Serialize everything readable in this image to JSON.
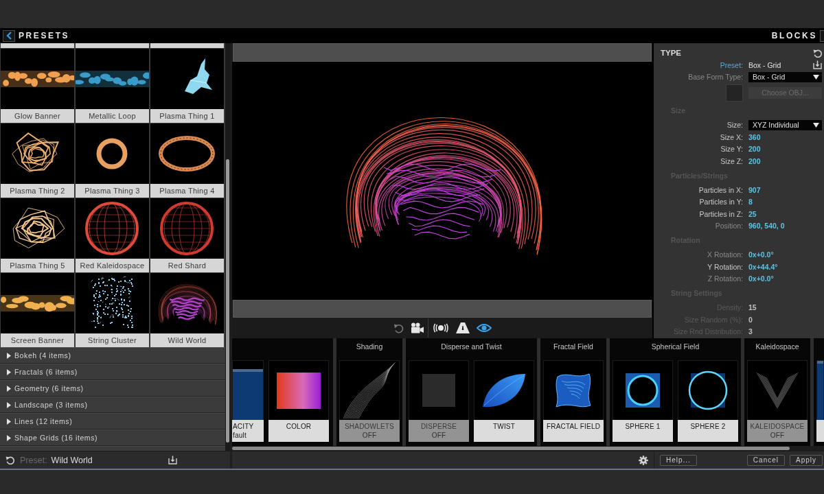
{
  "titlebar": {
    "left_title": "PRESETS",
    "right_title": "BLOCKS"
  },
  "presets": {
    "items": [
      {
        "name": "Glow Banner",
        "kind": "banner",
        "color": "#f0a050"
      },
      {
        "name": "Metallic Loop",
        "kind": "banner",
        "color": "#3a9ac8"
      },
      {
        "name": "Plasma Thing 1",
        "kind": "shard",
        "color": "#8fd8f0"
      },
      {
        "name": "Plasma Thing 2",
        "kind": "blob",
        "color": "#f0b070"
      },
      {
        "name": "Plasma Thing 3",
        "kind": "ring",
        "color": "#e8a060"
      },
      {
        "name": "Plasma Thing 4",
        "kind": "wide-ring",
        "color": "#d88850"
      },
      {
        "name": "Plasma Thing 5",
        "kind": "blob",
        "color": "#f5c890"
      },
      {
        "name": "Red Kaleidospace",
        "kind": "sphere",
        "color": "#e04a3a"
      },
      {
        "name": "Red Shard",
        "kind": "sphere",
        "color": "#d03a30"
      },
      {
        "name": "Screen Banner",
        "kind": "banner",
        "color": "#f0b050"
      },
      {
        "name": "String Cluster",
        "kind": "cluster",
        "color": "#8ac8e8"
      },
      {
        "name": "Wild World",
        "kind": "dome",
        "color": "#b040c8"
      }
    ],
    "categories": [
      {
        "label": "Bokeh (4 items)",
        "expanded": false
      },
      {
        "label": "Fractals (6 items)",
        "expanded": false
      },
      {
        "label": "Geometry (6 items)",
        "expanded": false
      },
      {
        "label": "Landscape (3 items)",
        "expanded": false
      },
      {
        "label": "Lines (12 items)",
        "expanded": false
      },
      {
        "label": "Shape Grids (16 items)",
        "expanded": false
      }
    ],
    "footer": {
      "label": "Preset:",
      "value": "Wild World"
    }
  },
  "viewport": {
    "tool_groups": [
      {
        "tools": [
          {
            "kind": "undo",
            "on": false,
            "disabled": true
          },
          {
            "kind": "camera",
            "on": false,
            "disabled": false
          }
        ]
      },
      {
        "tools": [
          {
            "kind": "waves",
            "on": false,
            "disabled": false
          },
          {
            "kind": "road",
            "on": false,
            "disabled": false
          },
          {
            "kind": "eye",
            "on": true,
            "disabled": false
          }
        ]
      }
    ]
  },
  "properties": {
    "title": "TYPE",
    "rows": [
      {
        "kind": "preset",
        "label": "Preset:",
        "value": "Box - Grid",
        "dimmed": false,
        "disabled": false
      },
      {
        "kind": "dropdown",
        "label": "Base Form Type:",
        "value": "Box - Grid",
        "dimmed": true,
        "disabled": false
      },
      {
        "kind": "button",
        "label": "Choose OBJ...",
        "dimmed": false,
        "disabled": true
      },
      {
        "kind": "header",
        "label": "Size"
      },
      {
        "kind": "dropdown",
        "label": "Size:",
        "value": "XYZ Individual",
        "dimmed": false,
        "disabled": false
      },
      {
        "kind": "value",
        "label": "Size X:",
        "value": "360",
        "dimmed": false,
        "disabled": false
      },
      {
        "kind": "value",
        "label": "Size Y:",
        "value": "200",
        "dimmed": false,
        "disabled": false
      },
      {
        "kind": "value",
        "label": "Size Z:",
        "value": "200",
        "dimmed": false,
        "disabled": false
      },
      {
        "kind": "header",
        "label": "Particles/Strings"
      },
      {
        "kind": "value",
        "label": "Particles in X:",
        "value": "907",
        "dimmed": false,
        "disabled": false
      },
      {
        "kind": "value",
        "label": "Particles in Y:",
        "value": "8",
        "dimmed": false,
        "disabled": false
      },
      {
        "kind": "value",
        "label": "Particles in Z:",
        "value": "25",
        "dimmed": false,
        "disabled": false
      },
      {
        "kind": "value",
        "label": "Position:",
        "value": "960, 540, 0",
        "dimmed": true,
        "disabled": false
      },
      {
        "kind": "header",
        "label": "Rotation"
      },
      {
        "kind": "value",
        "label": "X Rotation:",
        "value": "0x+0.0°",
        "dimmed": true,
        "disabled": false
      },
      {
        "kind": "value",
        "label": "Y Rotation:",
        "value": "0x+44.4°",
        "dimmed": false,
        "disabled": false
      },
      {
        "kind": "value",
        "label": "Z Rotation:",
        "value": "0x+0.0°",
        "dimmed": true,
        "disabled": false
      },
      {
        "kind": "header",
        "label": "String Settings"
      },
      {
        "kind": "value",
        "label": "Density:",
        "value": "15",
        "dimmed": false,
        "disabled": true
      },
      {
        "kind": "value",
        "label": "Size Random (%):",
        "value": "0",
        "dimmed": false,
        "disabled": true
      },
      {
        "kind": "value",
        "label": "Size Rnd Distribution:",
        "value": "3",
        "dimmed": false,
        "disabled": true
      }
    ]
  },
  "blocks": {
    "groups": [
      {
        "cards": [
          {
            "label": "ACITY",
            "sublabel": "fault",
            "on": true,
            "kind": "panel"
          },
          {
            "label": "COLOR",
            "on": true,
            "kind": "gradient"
          }
        ]
      },
      {
        "title": "Shading",
        "cards": [
          {
            "label": "SHADOWLETS",
            "sublabel": "OFF",
            "on": false,
            "kind": "strands"
          }
        ]
      },
      {
        "title": "Disperse and Twist",
        "cards": [
          {
            "label": "DISPERSE",
            "sublabel": "OFF",
            "on": false,
            "kind": "square"
          },
          {
            "label": "TWIST",
            "on": true,
            "kind": "leaf"
          }
        ]
      },
      {
        "title": "Fractal Field",
        "cards": [
          {
            "label": "FRACTAL FIELD",
            "on": true,
            "kind": "warp"
          }
        ]
      },
      {
        "title": "Spherical Field",
        "cards": [
          {
            "label": "SPHERE 1",
            "on": true,
            "kind": "ring"
          },
          {
            "label": "SPHERE 2",
            "on": true,
            "kind": "halo"
          }
        ]
      },
      {
        "title": "Kaleidospace",
        "cards": [
          {
            "label": "KALEIDOSPACE",
            "sublabel": "OFF",
            "on": false,
            "kind": "chevron"
          }
        ]
      },
      {
        "cards": [
          {
            "on": true,
            "kind": "panel"
          }
        ]
      }
    ]
  },
  "footer": {
    "help_button": "Help...",
    "buttons": [
      "Cancel",
      "Apply"
    ]
  }
}
